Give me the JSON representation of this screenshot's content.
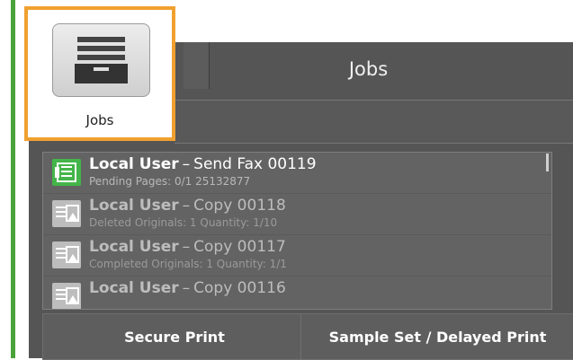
{
  "app": {
    "title": "Jobs",
    "tile_label": "Jobs",
    "tile_icon": "job-drawer-icon"
  },
  "jobs": [
    {
      "user": "Local User",
      "title": "Send Fax 00119",
      "subtitle": "Pending Pages: 0/1 25132877",
      "icon": "fax-icon",
      "state": "active"
    },
    {
      "user": "Local User",
      "title": "Copy 00118",
      "subtitle": "Deleted Originals: 1 Quantity: 1/10",
      "icon": "copy-icon",
      "state": "dim"
    },
    {
      "user": "Local User",
      "title": "Copy 00117",
      "subtitle": "Completed Originals: 1 Quantity: 1/1",
      "icon": "copy-icon",
      "state": "dim"
    },
    {
      "user": "Local User",
      "title": "Copy 00116",
      "subtitle": "",
      "icon": "copy-icon",
      "state": "dim"
    }
  ],
  "buttons": {
    "secure_print": "Secure Print",
    "sample_set": "Sample Set / Delayed Print"
  },
  "colors": {
    "accent": "#f0a030",
    "sidebar_green": "#4aa33a",
    "fax_green": "#44b54a",
    "panel_bg": "#555555"
  }
}
